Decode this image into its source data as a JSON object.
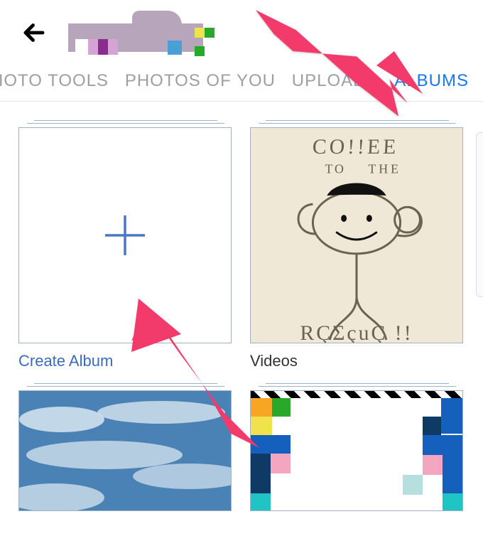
{
  "header": {
    "back_icon": "←"
  },
  "tabs": {
    "items": [
      {
        "label": "PHOTO TOOLS",
        "active": false
      },
      {
        "label": "PHOTOS OF YOU",
        "active": false
      },
      {
        "label": "UPLOADS",
        "active": false
      },
      {
        "label": "ALBUMS",
        "active": true
      }
    ]
  },
  "albums": {
    "create_label": "Create Album",
    "items": [
      {
        "label": "Videos"
      }
    ]
  },
  "coffee_text": {
    "line1": "COFFEE",
    "line2": "TO",
    "line3": "THE",
    "line4": "RESCUE!!"
  }
}
